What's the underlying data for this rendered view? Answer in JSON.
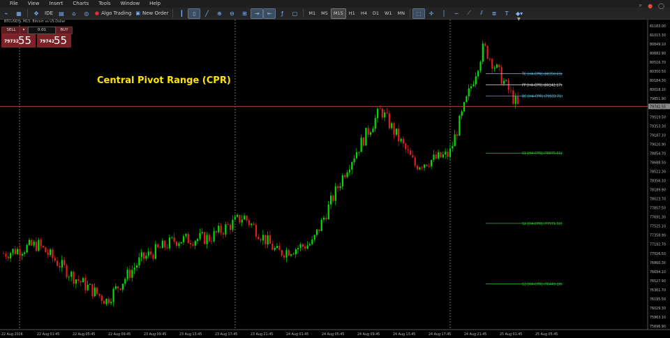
{
  "menu": [
    "File",
    "View",
    "Insert",
    "Charts",
    "Tools",
    "Window",
    "Help"
  ],
  "toolbar": {
    "ide_label": "IDE",
    "algo_label": "Algo Trading",
    "new_order_label": "New Order",
    "timeframes": [
      "M1",
      "M5",
      "M15",
      "H1",
      "H4",
      "D1",
      "W1",
      "MN"
    ],
    "active_timeframe": "M15"
  },
  "symbol_line": "BTCUSD!s, M15:  Bitcoin vs US Dollar",
  "trade": {
    "sell_label": "SELL",
    "buy_label": "BUY",
    "lot": "0.01",
    "sell_small": "79732",
    "sell_big": "55",
    "buy_small": "79742",
    "buy_big": "55"
  },
  "title": "Central Pivot Range (CPR)",
  "price_axis": [
    "81183.00",
    "81015.30",
    "80849.10",
    "80682.90",
    "80516.70",
    "80350.50",
    "80184.30",
    "80018.10",
    "79851.90",
    "79685.70",
    "79519.50",
    "79353.30",
    "79187.10",
    "79020.90",
    "78854.70",
    "78688.50",
    "78522.30",
    "78356.10",
    "78189.90",
    "78023.70",
    "77857.50",
    "77691.30",
    "77525.10",
    "77358.90",
    "77192.70",
    "77026.50",
    "76860.30",
    "76694.10",
    "76527.90",
    "76361.70",
    "76195.50",
    "76029.30",
    "75863.10",
    "75696.90"
  ],
  "current_price_label": "79742.55",
  "time_axis": [
    "22 Aug 2026",
    "22 Aug 01:45",
    "22 Aug 05:45",
    "22 Aug 09:45",
    "23 Aug 09:45",
    "23 Aug 13:45",
    "23 Aug 17:45",
    "23 Aug 21:45",
    "24 Aug 01:45",
    "24 Aug 05:45",
    "24 Aug 09:45",
    "24 Aug 13:45",
    "24 Aug 17:45",
    "24 Aug 21:45",
    "25 Aug 01:45",
    "25 Aug 05:45"
  ],
  "pivot_levels": [
    {
      "label": "TC [H4-CPR] (80350.63)",
      "price": 80350.63,
      "color": "#5fc6e6"
    },
    {
      "label": "PP [H4-CPR] (80142.17)",
      "price": 80142.17,
      "color": "#e0e0e0"
    },
    {
      "label": "BC [H4-CPR] (79933.71)",
      "price": 79933.71,
      "color": "#5fc6e6"
    },
    {
      "label": "S1 [H4-CPR] (78875.51)",
      "price": 78875.51,
      "color": "#2ec22e"
    },
    {
      "label": "S2 [H4-CPR] (77571.52)",
      "price": 77571.52,
      "color": "#2ec22e"
    },
    {
      "label": "S3 [H4-CPR] (76449.28)",
      "price": 76449.28,
      "color": "#2ec22e"
    }
  ],
  "colors": {
    "bull": "#00e000",
    "bear": "#e02020",
    "price_line": "#c84a4a",
    "axis_text": "#bdbdbd"
  },
  "chart_data": {
    "type": "line",
    "x": [
      "22 Aug 2026",
      "22 Aug 01:45",
      "22 Aug 05:45",
      "22 Aug 09:45",
      "23 Aug 09:45",
      "23 Aug 13:45",
      "23 Aug 17:45",
      "23 Aug 21:45",
      "24 Aug 01:45",
      "24 Aug 05:45",
      "24 Aug 09:45",
      "24 Aug 13:45",
      "24 Aug 17:45",
      "24 Aug 21:45",
      "25 Aug 01:45",
      "25 Aug 05:45"
    ],
    "series": [
      {
        "values": [
          77010,
          77180,
          76600,
          76140,
          76900,
          77260,
          77300,
          77700,
          77020,
          77200,
          78600,
          79680,
          78650,
          78850,
          80850,
          79742
        ]
      }
    ],
    "ylim": [
      75600,
      81250
    ]
  }
}
